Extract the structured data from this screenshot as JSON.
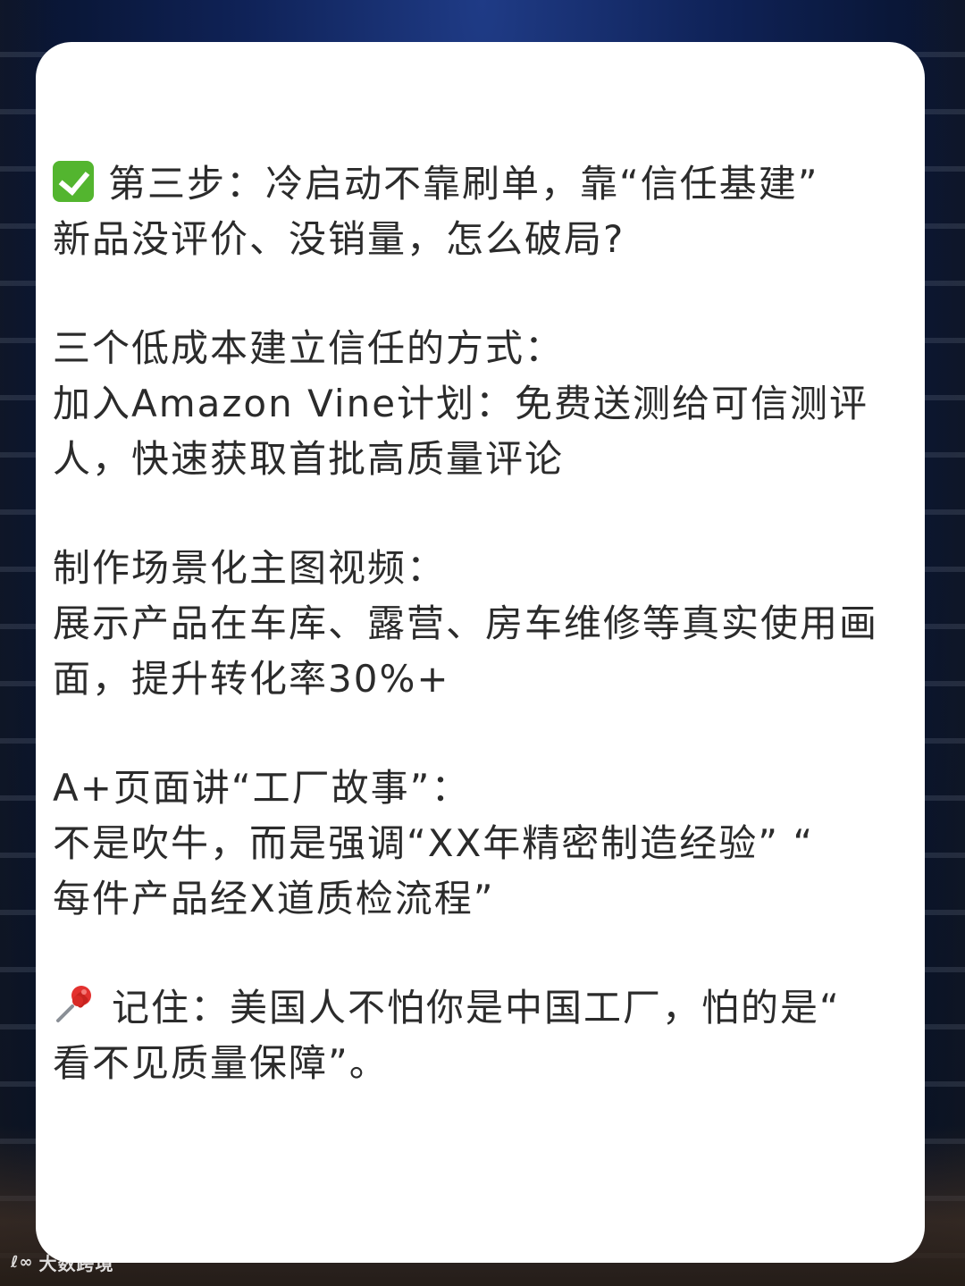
{
  "content": {
    "step": {
      "icon": "check-mark-button-icon",
      "lines": [
        "第三步：冷启动不靠刷单，靠“信任基建”",
        "新品没评价、没销量，怎么破局?"
      ]
    },
    "ways": {
      "lines": [
        "三个低成本建立信任的方式：",
        "加入Amazon Vine计划：免费送测给可信测评",
        "人，快速获取首批高质量评论"
      ]
    },
    "video": {
      "lines": [
        "制作场景化主图视频：",
        "展示产品在车库、露营、房车维修等真实使用画",
        "面，提升转化率30%+"
      ]
    },
    "aplus": {
      "lines": [
        "A+页面讲“工厂故事”：",
        "不是吹牛，而是强调“XX年精密制造经验” “",
        "每件产品经X道质检流程”"
      ]
    },
    "remember": {
      "icon": "pushpin-icon",
      "lines": [
        "记住：美国人不怕你是中国工厂，怕的是“",
        "看不见质量保障”。"
      ]
    }
  },
  "watermark": {
    "logo": "ℓ∞",
    "text": "大数跨境"
  }
}
